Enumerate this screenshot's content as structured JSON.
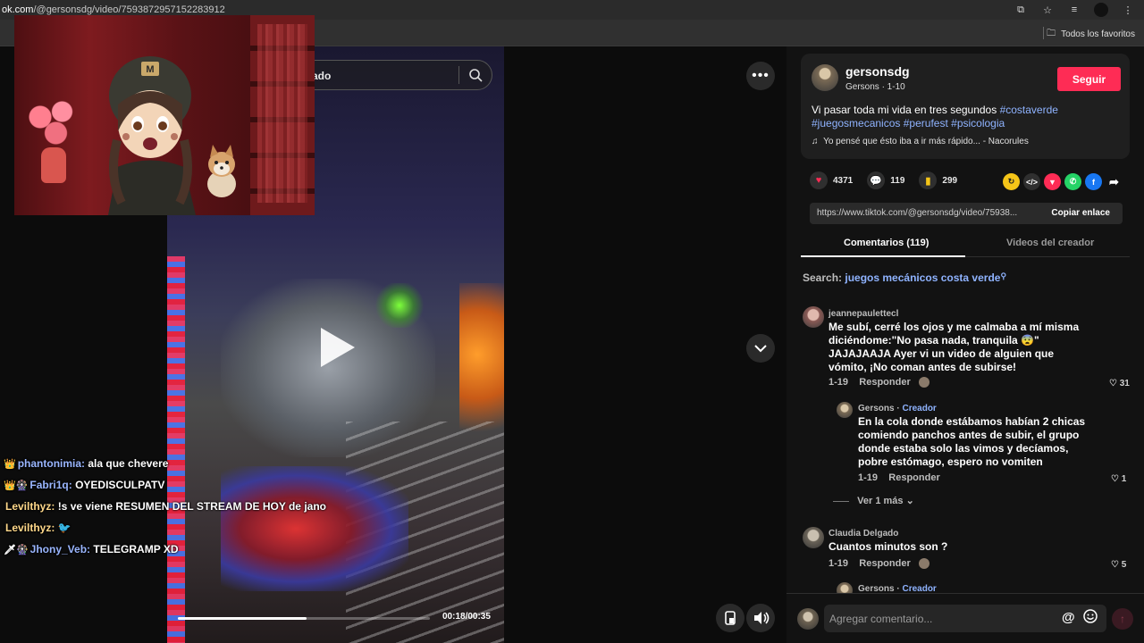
{
  "browser": {
    "url_domain": "ok.com",
    "url_path": "/@gersonsdg/video/7593872957152283912",
    "bookmarks_label": "Todos los favoritos"
  },
  "search": {
    "text": "ado"
  },
  "video": {
    "timecode": "00:18/00:35",
    "progress": 0.51
  },
  "chat": [
    {
      "badges": "👑",
      "user": "phantonimia:",
      "user_color": "#9ab6ff",
      "message": "ala que chevere"
    },
    {
      "badges": "👑🎡",
      "user": "Fabri1q:",
      "user_color": "#9ab6ff",
      "message": "OYEDISCULPATV"
    },
    {
      "badges": "",
      "user": "Levilthyz:",
      "user_color": "#ffd88a",
      "message": "!s ve viene RESUMEN DEL STREAM DE HOY de jano"
    },
    {
      "badges": "",
      "user": "Levilthyz:",
      "user_color": "#ffd88a",
      "message": "🐦"
    },
    {
      "badges": "🗡🎡",
      "user": "Jhony_Veb:",
      "user_color": "#9ab6ff",
      "message": "TELEGRAMP XD"
    }
  ],
  "panel": {
    "author": "gersonsdg",
    "subtitle": "Gersons · 1-10",
    "follow_label": "Seguir",
    "desc_text": "Vi pasar toda mi vida en tres segundos ",
    "tags": [
      "#costaverde",
      "#juegosmecanicos",
      "#perufest",
      "#psicologia"
    ],
    "music": "Yo pensé que ésto iba a ir más rápido... - Nacorules",
    "likes": "4371",
    "comments": "119",
    "saves": "299",
    "link_url": "https://www.tiktok.com/@gersonsdg/video/75938...",
    "copy_label": "Copiar enlace",
    "tab_comments": "Comentarios (119)",
    "tab_videos": "Videos del creador",
    "search_label": "Search:",
    "search_query": "juegos mecánicos costa verde"
  },
  "comments": [
    {
      "user": "jeannepaulettecl",
      "text": "Me subí, cerré los ojos y me calmaba a mí misma diciéndome:\"No pasa nada, tranquila 😨\" JAJAJAAJA Ayer vi un video de alguien que vómito, ¡No coman antes de subirse!",
      "date": "1-19",
      "reply": "Responder",
      "likes": "31"
    },
    {
      "user": "Gersons",
      "role": "Creador",
      "text": "En la cola donde estábamos habían 2 chicas comiendo panchos antes de subir, el grupo donde estaba solo las vimos y decíamos, pobre estómago, espero no vomiten",
      "date": "1-19",
      "reply": "Responder",
      "likes": "1"
    },
    {
      "more": "Ver 1 más"
    },
    {
      "user": "Claudia Delgado",
      "text": "Cuantos minutos son ?",
      "date": "1-19",
      "reply": "Responder",
      "likes": "5"
    },
    {
      "user": "Gersons",
      "role": "Creador"
    }
  ],
  "comment_box": {
    "placeholder": "Agregar comentario..."
  },
  "colors": {
    "accent": "#fe2c55",
    "hashtag": "#8fb3ff"
  }
}
